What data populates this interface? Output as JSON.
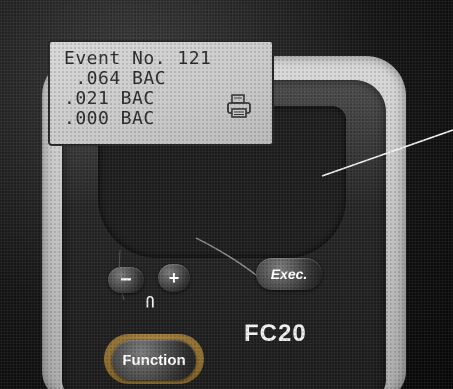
{
  "display": {
    "lines": [
      "Event No. 121",
      " .064 BAC",
      ".021 BAC",
      ".000 BAC"
    ]
  },
  "buttons": {
    "minus": "−",
    "plus": "+",
    "exec": "Exec.",
    "function": "Function"
  },
  "symbol_below_minus": "Ⴖ",
  "brand": "FC20",
  "icons": {
    "printer": "printer-icon"
  },
  "colors": {
    "device_body": "#c4c4c4",
    "bezel": "#1c1c1c",
    "lcd": "#c8c8c8",
    "function_ring": "#a07a3c"
  }
}
